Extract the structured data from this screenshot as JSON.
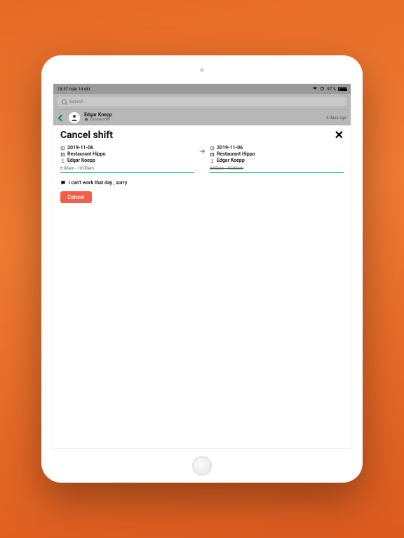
{
  "status": {
    "time": "18:57",
    "date": "mån 14 okt.",
    "battery_pct": "97 %"
  },
  "search": {
    "placeholder": "Search"
  },
  "header": {
    "user_name": "Edgar Koepp",
    "subtitle": "Cancel shift",
    "timestamp": "4 days ago"
  },
  "panel": {
    "title": "Cancel shift"
  },
  "original": {
    "date": "2019-11-06",
    "location": "Restaurant Hippo",
    "person": "Edgar Koepp",
    "time": "6:00am - 10:00am"
  },
  "requested": {
    "date": "2019-11-06",
    "location": "Restaurant Hippo",
    "person": "Edgar Koepp",
    "time": "6:00am - 10:00am"
  },
  "comment": "i can't work that day , sorry",
  "buttons": {
    "cancel": "Cancel"
  }
}
